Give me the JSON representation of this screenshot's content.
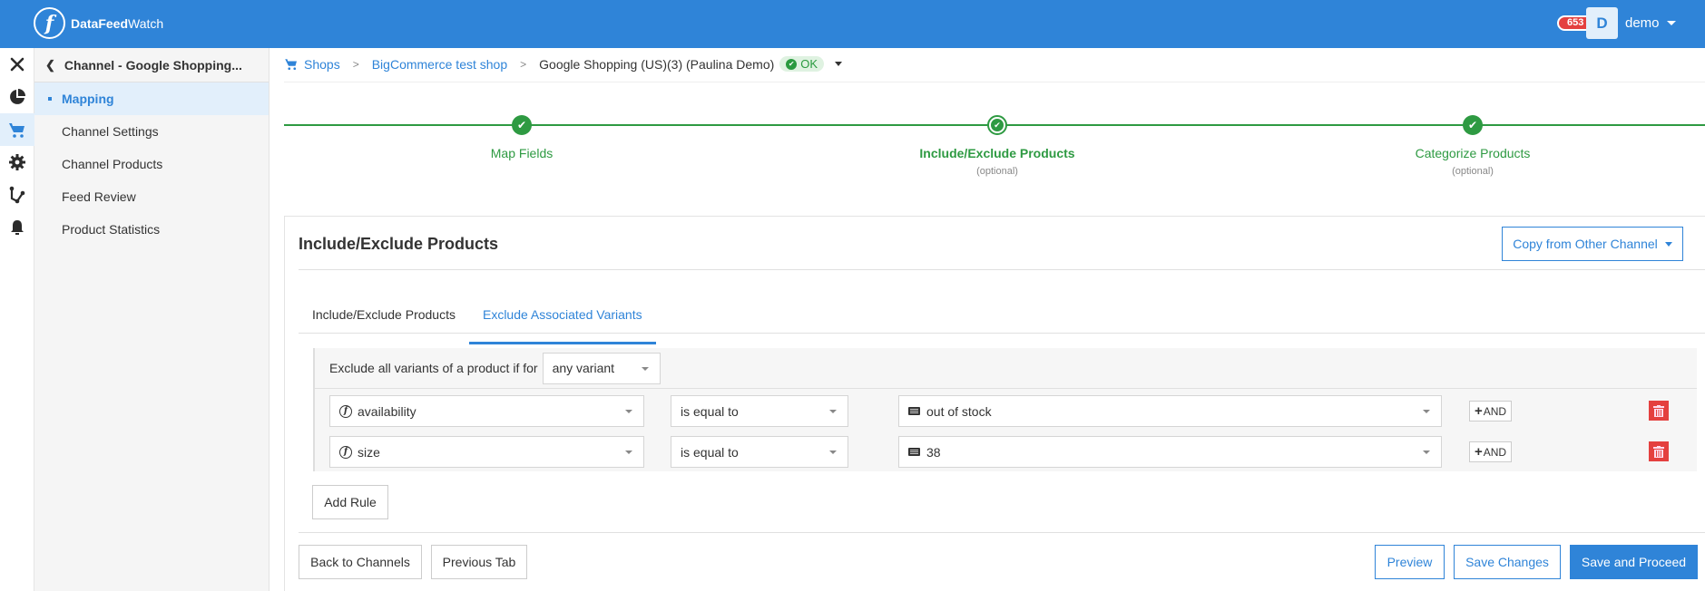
{
  "header": {
    "brand_bold": "DataFeed",
    "brand_light": "Watch",
    "logo_glyph": "f",
    "notification_count": "653",
    "avatar_initial": "D",
    "username": "demo"
  },
  "rail": {
    "icons": [
      "close-icon",
      "pie-chart-icon",
      "cart-icon",
      "gear-icon",
      "flow-icon",
      "bell-icon"
    ],
    "active": "cart-icon"
  },
  "sidebar": {
    "title": "Channel - Google Shopping...",
    "items": [
      {
        "label": "Mapping",
        "active": true
      },
      {
        "label": "Channel Settings"
      },
      {
        "label": "Channel Products"
      },
      {
        "label": "Feed Review"
      },
      {
        "label": "Product Statistics"
      }
    ]
  },
  "breadcrumb": {
    "items": [
      "Shops",
      "BigCommerce test shop"
    ],
    "current": "Google Shopping (US)(3) (Paulina Demo)",
    "status": "OK"
  },
  "stepper": {
    "steps": [
      {
        "label": "Map Fields",
        "sub": "",
        "state": "done"
      },
      {
        "label": "Include/Exclude Products",
        "sub": "(optional)",
        "state": "current"
      },
      {
        "label": "Categorize Products",
        "sub": "(optional)",
        "state": "done"
      }
    ]
  },
  "card": {
    "title": "Include/Exclude Products",
    "copy_button": "Copy from Other Channel",
    "tabs": [
      {
        "label": "Include/Exclude Products",
        "active": false
      },
      {
        "label": "Exclude Associated Variants",
        "active": true
      }
    ],
    "rule_intro": "Exclude all variants of a product if for",
    "variant_scope": "any variant",
    "rules": [
      {
        "field": "availability",
        "operator": "is equal to",
        "value": "out of stock",
        "and_label": "AND"
      },
      {
        "field": "size",
        "operator": "is equal to",
        "value": "38",
        "and_label": "AND"
      }
    ],
    "add_rule": "Add Rule"
  },
  "footer": {
    "back": "Back to Channels",
    "previous": "Previous Tab",
    "preview": "Preview",
    "save": "Save Changes",
    "save_proceed": "Save and Proceed"
  },
  "colors": {
    "brand": "#2f84d8",
    "success": "#2e9a42",
    "danger": "#e4403f"
  }
}
